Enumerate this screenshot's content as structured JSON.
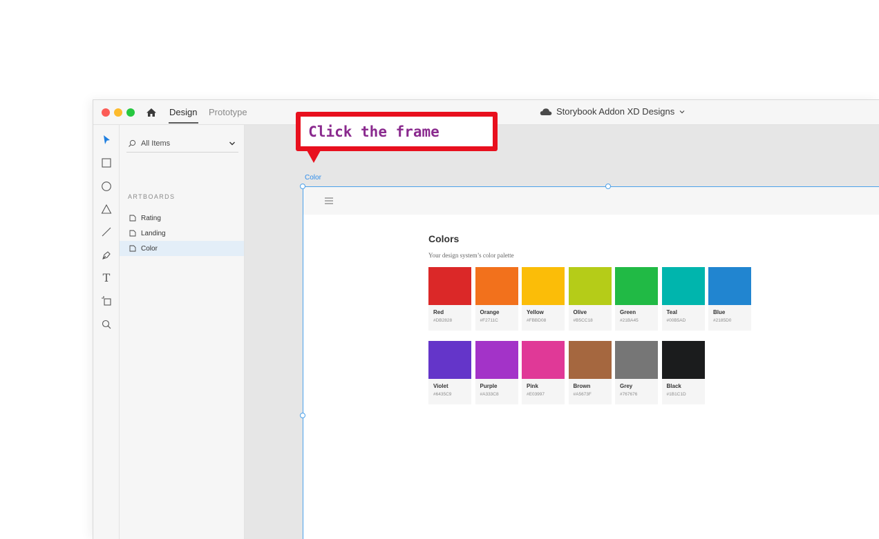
{
  "titlebar": {
    "tabs": [
      {
        "label": "Design",
        "active": true
      },
      {
        "label": "Prototype",
        "active": false
      }
    ],
    "document_title": "Storybook Addon XD Designs"
  },
  "toolbar": {
    "tools": [
      "select-icon",
      "rectangle-icon",
      "ellipse-icon",
      "polygon-icon",
      "line-icon",
      "pen-icon",
      "text-icon",
      "artboard-icon",
      "zoom-icon"
    ],
    "text_tool_glyph": "T"
  },
  "layers": {
    "filter_label": "All Items",
    "section_heading": "ARTBOARDS",
    "items": [
      {
        "label": "Rating",
        "selected": false
      },
      {
        "label": "Landing",
        "selected": false
      },
      {
        "label": "Color",
        "selected": true
      }
    ]
  },
  "canvas": {
    "artboard_label": "Color",
    "artboard": {
      "title": "Colors",
      "subtitle": "Your design system’s color palette",
      "swatches": [
        {
          "name": "Red",
          "hex": "#DB2828"
        },
        {
          "name": "Orange",
          "hex": "#F2711C"
        },
        {
          "name": "Yellow",
          "hex": "#FBBD08"
        },
        {
          "name": "Olive",
          "hex": "#B5CC18"
        },
        {
          "name": "Green",
          "hex": "#21BA45"
        },
        {
          "name": "Teal",
          "hex": "#00B5AD"
        },
        {
          "name": "Blue",
          "hex": "#2185D0"
        },
        {
          "name": "Violet",
          "hex": "#6435C9"
        },
        {
          "name": "Purple",
          "hex": "#A333C8"
        },
        {
          "name": "Pink",
          "hex": "#E03997"
        },
        {
          "name": "Brown",
          "hex": "#A5673F"
        },
        {
          "name": "Grey",
          "hex": "#767676"
        },
        {
          "name": "Black",
          "hex": "#1B1C1D"
        }
      ]
    }
  },
  "callout": {
    "text": "Click the frame"
  },
  "colors": {
    "selection": "#4aa0ea",
    "callout_border": "#e8101e",
    "callout_text": "#8a2a8e"
  }
}
